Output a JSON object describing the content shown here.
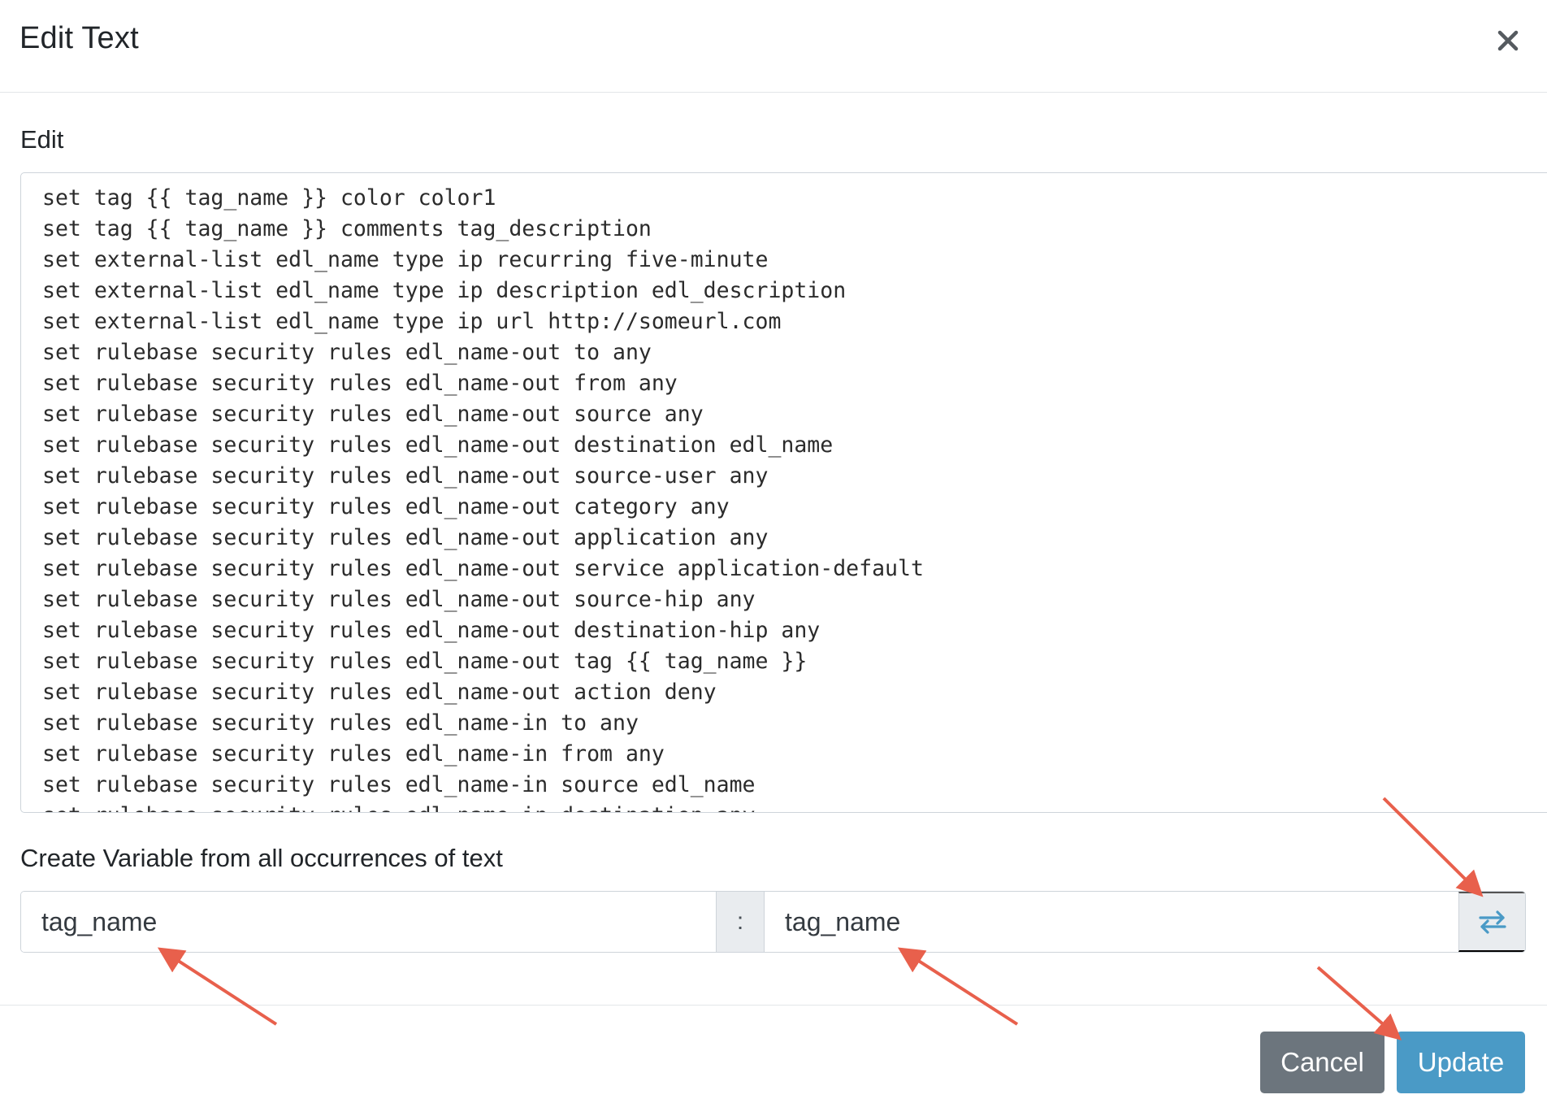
{
  "modal": {
    "title": "Edit Text",
    "close_icon": "close-icon"
  },
  "edit": {
    "label": "Edit",
    "lines": [
      "set tag {{ tag_name }} color color1",
      "set tag {{ tag_name }} comments tag_description",
      "set external-list edl_name type ip recurring five-minute",
      "set external-list edl_name type ip description edl_description",
      "set external-list edl_name type ip url http://someurl.com",
      "set rulebase security rules edl_name-out to any",
      "set rulebase security rules edl_name-out from any",
      "set rulebase security rules edl_name-out source any",
      "set rulebase security rules edl_name-out destination edl_name",
      "set rulebase security rules edl_name-out source-user any",
      "set rulebase security rules edl_name-out category any",
      "set rulebase security rules edl_name-out application any",
      "set rulebase security rules edl_name-out service application-default",
      "set rulebase security rules edl_name-out source-hip any",
      "set rulebase security rules edl_name-out destination-hip any",
      "set rulebase security rules edl_name-out tag {{ tag_name }}",
      "set rulebase security rules edl_name-out action deny",
      "set rulebase security rules edl_name-in to any",
      "set rulebase security rules edl_name-in from any",
      "set rulebase security rules edl_name-in source edl_name",
      "set rulebase security rules edl_name-in destination any"
    ]
  },
  "variable": {
    "label": "Create Variable from all occurrences of text",
    "find_value": "tag_name",
    "separator": ":",
    "replace_value": "tag_name",
    "swap_icon": "swap-arrows-icon"
  },
  "footer": {
    "cancel_label": "Cancel",
    "update_label": "Update"
  },
  "colors": {
    "primary": "#4a9ac6",
    "secondary": "#6c757d",
    "annotation_arrow": "#e8604c"
  }
}
